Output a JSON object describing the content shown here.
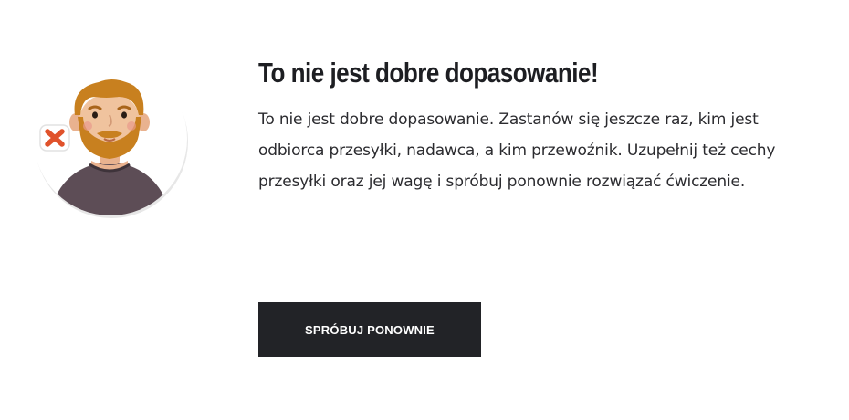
{
  "feedback": {
    "title": "To nie jest dobre dopasowanie!",
    "message": "To nie jest dobre dopasowanie. Zastanów się jeszcze raz, kim jest odbiorca przesyłki, nadawca, a kim przewoźnik. Uzupełnij też cechy przesyłki oraz jej wagę i spróbuj ponownie rozwiązać ćwiczenie.",
    "retry_label": "SPRÓBUJ PONOWNIE"
  },
  "illustration": {
    "avatar": "bearded-man-avatar",
    "badge_icon": "close-icon",
    "badge_color": "#e0522b",
    "hair_color": "#c8801f",
    "shirt_color": "#5d4d56"
  },
  "colors": {
    "button_background": "#222327",
    "button_text": "#ffffff",
    "title_text": "#1d1e22",
    "body_text": "#2b2b2f"
  }
}
